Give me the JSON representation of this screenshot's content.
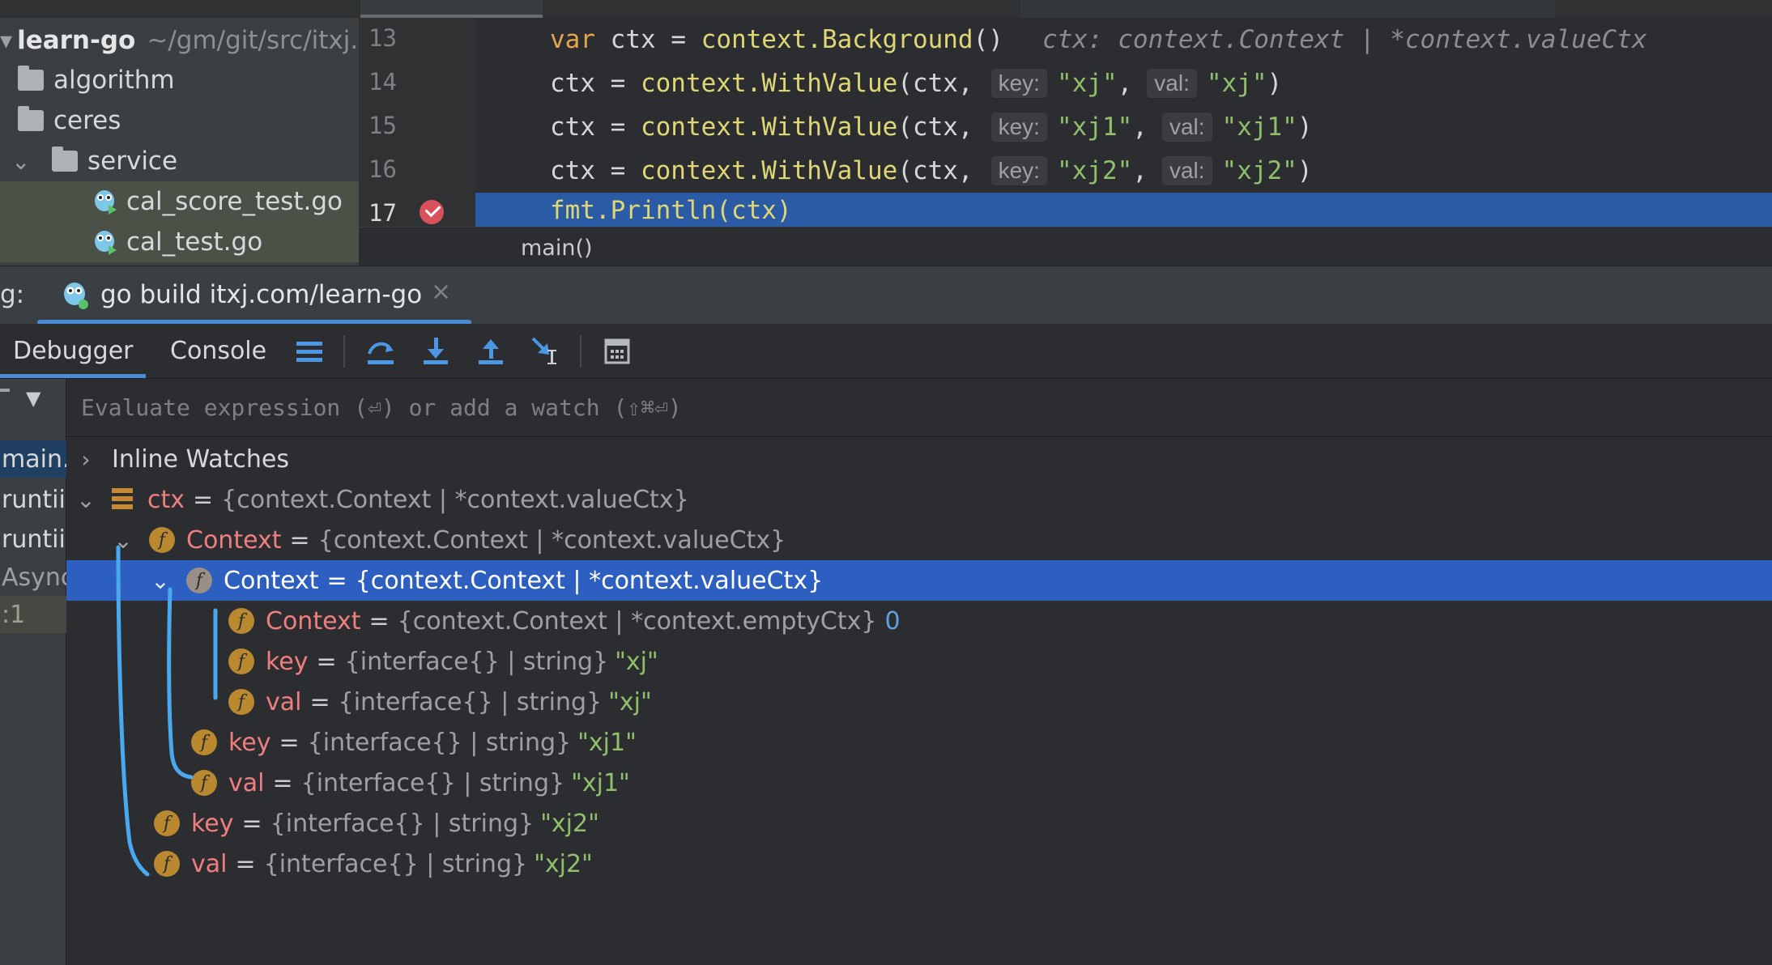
{
  "project": {
    "root_name": "learn-go",
    "root_path": "~/gm/git/src/itxj.",
    "folders": [
      "algorithm",
      "ceres",
      "service"
    ],
    "files": [
      "cal_score_test.go",
      "cal_test.go"
    ]
  },
  "editor": {
    "lines": [
      {
        "num": "13",
        "var_kw": "var",
        "lhs": "ctx = ",
        "fn": "context.Background",
        "rest": "()",
        "inline_value": "ctx: context.Context | *context.valueCtx"
      },
      {
        "num": "14",
        "lhs": "ctx = ",
        "fn": "context.WithValue",
        "args": "(ctx,",
        "key_hint": "key:",
        "key": "\"xj\"",
        "val_hint": "val:",
        "val": "\"xj\"",
        "close": ")"
      },
      {
        "num": "15",
        "lhs": "ctx = ",
        "fn": "context.WithValue",
        "args": "(ctx,",
        "key_hint": "key:",
        "key": "\"xj1\"",
        "val_hint": "val:",
        "val": "\"xj1\"",
        "close": ")"
      },
      {
        "num": "16",
        "lhs": "ctx = ",
        "fn": "context.WithValue",
        "args": "(ctx,",
        "key_hint": "key:",
        "key": "\"xj2\"",
        "val_hint": "val:",
        "val": "\"xj2\"",
        "close": ")"
      },
      {
        "num": "17",
        "code": "fmt.Println(ctx)"
      }
    ],
    "breadcrumb": "main()"
  },
  "debug": {
    "prefix": "g:",
    "run_tab": "go build itxj.com/learn-go",
    "close_glyph": "×",
    "tabs": [
      "Debugger",
      "Console"
    ],
    "watch_placeholder": "Evaluate expression (⏎) or add a watch (⇧⌘⏎)"
  },
  "frames": [
    "main.",
    "runtii",
    "runtii",
    "Async",
    ":1"
  ],
  "variables": {
    "inline_watches": "Inline Watches",
    "ctx": {
      "name": "ctx",
      "type": "{context.Context | *context.valueCtx}"
    },
    "context1": {
      "name": "Context",
      "type": "{context.Context | *context.valueCtx}"
    },
    "context2": {
      "name": "Context",
      "type": "{context.Context | *context.valueCtx}"
    },
    "context3": {
      "name": "Context",
      "type": "{context.Context | *context.emptyCtx}",
      "value": "0"
    },
    "key_xj": {
      "name": "key",
      "type": "{interface{} | string}",
      "value": "\"xj\""
    },
    "val_xj": {
      "name": "val",
      "type": "{interface{} | string}",
      "value": "\"xj\""
    },
    "key_xj1": {
      "name": "key",
      "type": "{interface{} | string}",
      "value": "\"xj1\""
    },
    "val_xj1": {
      "name": "val",
      "type": "{interface{} | string}",
      "value": "\"xj1\""
    },
    "key_xj2": {
      "name": "key",
      "type": "{interface{} | string}",
      "value": "\"xj2\""
    },
    "val_xj2": {
      "name": "val",
      "type": "{interface{} | string}",
      "value": "\"xj2\""
    }
  },
  "colors": {
    "selection": "#2d5fc0",
    "exec_line": "#2c5ba6",
    "annotation": "#4aa8ee",
    "field_icon": "#b9882f"
  }
}
